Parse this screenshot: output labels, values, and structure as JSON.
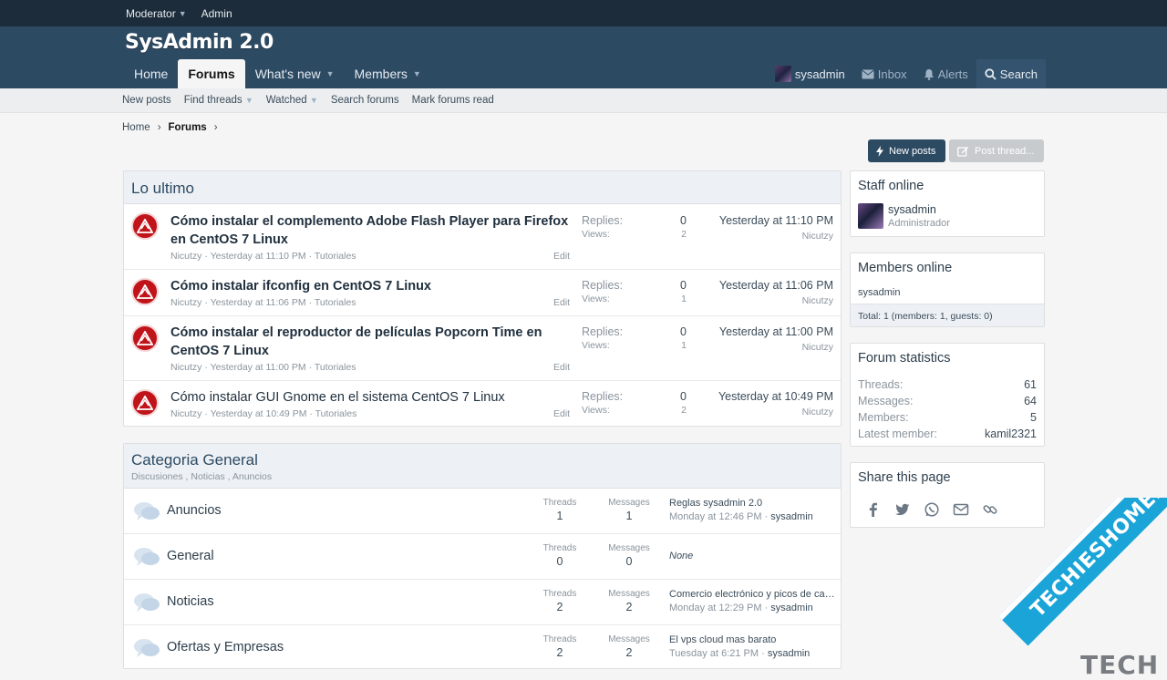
{
  "staffbar": {
    "moderator": "Moderator",
    "admin": "Admin"
  },
  "brand": {
    "logo": "SysAdmin 2.0"
  },
  "nav": {
    "tabs": [
      {
        "label": "Home"
      },
      {
        "label": "Forums"
      },
      {
        "label": "What's new"
      },
      {
        "label": "Members"
      }
    ],
    "user": "sysadmin",
    "inbox": "Inbox",
    "alerts": "Alerts",
    "search": "Search"
  },
  "subnav": [
    "New posts",
    "Find threads",
    "Watched",
    "Search forums",
    "Mark forums read"
  ],
  "breadcrumb": {
    "home": "Home",
    "current": "Forums"
  },
  "buttons": {
    "new_posts": "New posts",
    "post_thread": "Post thread..."
  },
  "latest": {
    "title": "Lo ultimo",
    "threads": [
      {
        "title": "Cómo instalar el complemento Adobe Flash Player para Firefox en CentOS 7 Linux",
        "author": "Nicutzy",
        "date": "Yesterday at 11:10 PM",
        "forum": "Tutoriales",
        "edit": "Edit",
        "replies_label": "Replies:",
        "replies": "0",
        "views_label": "Views:",
        "views": "2",
        "last_date": "Yesterday at 11:10 PM",
        "last_user": "Nicutzy"
      },
      {
        "title": "Cómo instalar ifconfig en CentOS 7 Linux",
        "author": "Nicutzy",
        "date": "Yesterday at 11:06 PM",
        "forum": "Tutoriales",
        "edit": "Edit",
        "replies_label": "Replies:",
        "replies": "0",
        "views_label": "Views:",
        "views": "1",
        "last_date": "Yesterday at 11:06 PM",
        "last_user": "Nicutzy"
      },
      {
        "title": "Cómo instalar el reproductor de películas Popcorn Time en CentOS 7 Linux",
        "author": "Nicutzy",
        "date": "Yesterday at 11:00 PM",
        "forum": "Tutoriales",
        "edit": "Edit",
        "replies_label": "Replies:",
        "replies": "0",
        "views_label": "Views:",
        "views": "1",
        "last_date": "Yesterday at 11:00 PM",
        "last_user": "Nicutzy"
      },
      {
        "title": "Cómo instalar GUI Gnome en el sistema CentOS 7 Linux",
        "author": "Nicutzy",
        "date": "Yesterday at 10:49 PM",
        "forum": "Tutoriales",
        "edit": "Edit",
        "replies_label": "Replies:",
        "replies": "0",
        "views_label": "Views:",
        "views": "2",
        "last_date": "Yesterday at 10:49 PM",
        "last_user": "Nicutzy"
      }
    ]
  },
  "category": {
    "title": "Categoria General",
    "subforums": "Discusiones , Noticias , Anuncios",
    "threads_label": "Threads",
    "messages_label": "Messages",
    "forums": [
      {
        "name": "Anuncios",
        "threads": "1",
        "messages": "1",
        "last_title": "Reglas sysadmin 2.0",
        "last_date": "Monday at 12:46 PM",
        "last_user": "sysadmin"
      },
      {
        "name": "General",
        "threads": "0",
        "messages": "0",
        "last_title": "None",
        "last_date": "",
        "last_user": ""
      },
      {
        "name": "Noticias",
        "threads": "2",
        "messages": "2",
        "last_title": "Comercio electrónico y picos de carga",
        "last_date": "Monday at 12:29 PM",
        "last_user": "sysadmin"
      },
      {
        "name": "Ofertas y Empresas",
        "threads": "2",
        "messages": "2",
        "last_title": "El vps cloud mas barato",
        "last_date": "Tuesday at 6:21 PM",
        "last_user": "sysadmin"
      }
    ]
  },
  "sidebar": {
    "staff": {
      "title": "Staff online",
      "name": "sysadmin",
      "role": "Administrador"
    },
    "members": {
      "title": "Members online",
      "list": "sysadmin",
      "total": "Total: 1 (members: 1, guests: 0)"
    },
    "stats": {
      "title": "Forum statistics",
      "rows": [
        {
          "k": "Threads:",
          "v": "61"
        },
        {
          "k": "Messages:",
          "v": "64"
        },
        {
          "k": "Members:",
          "v": "5"
        },
        {
          "k": "Latest member:",
          "v": "kamil2321"
        }
      ]
    },
    "share": {
      "title": "Share this page"
    }
  },
  "watermark": {
    "text": "TECHIESHOME.COM",
    "dark": "TECH"
  },
  "colors": {
    "header": "#2d4a63",
    "staffbar": "#1c2c3a",
    "accent": "#c0141a"
  }
}
